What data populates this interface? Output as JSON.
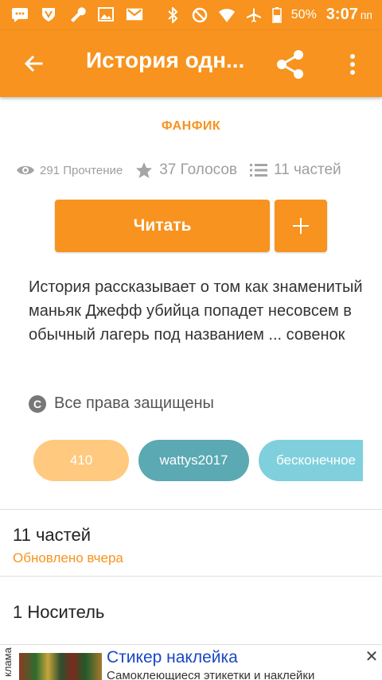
{
  "status_bar": {
    "battery_text": "50%",
    "time": "3:07",
    "time_suffix": "пп",
    "icons": [
      "message-icon",
      "vpn-icon",
      "wrench-icon",
      "image-icon",
      "gmail-icon",
      "bluetooth-icon",
      "block-icon",
      "wifi-icon",
      "airplane-icon",
      "battery-icon"
    ]
  },
  "appbar": {
    "title": "История одн...",
    "back_icon": "arrow-back-icon",
    "share_icon": "share-icon",
    "more_icon": "more-vert-icon",
    "color": "#f7931e"
  },
  "story": {
    "category": "ФАНФИК",
    "reads": "291 Прочтение",
    "votes": "37 Голосов",
    "parts": "11 частей",
    "read_button": "Читать",
    "add_button": "+",
    "description": "История рассказывает о том как знаменитый маньяк Джефф убийца попадет несовсем в обычный лагерь под названием ... совенок",
    "rights": "Все права защищены",
    "rights_icon": "C",
    "tags": [
      {
        "label": "410",
        "color": "#ffc97f"
      },
      {
        "label": "wattys2017",
        "color": "#5aa9b3"
      },
      {
        "label": "бесконечное",
        "color": "#7fd0dc"
      }
    ]
  },
  "parts_section": {
    "title": "11 частей",
    "updated": "Обновлено вчера"
  },
  "owner_section": {
    "title": "1 Носитель"
  },
  "ad": {
    "label": "клама",
    "title": "Стикер наклейка",
    "subtitle": "Самоклеющиеся этикетки и наклейки",
    "close": "✕"
  }
}
